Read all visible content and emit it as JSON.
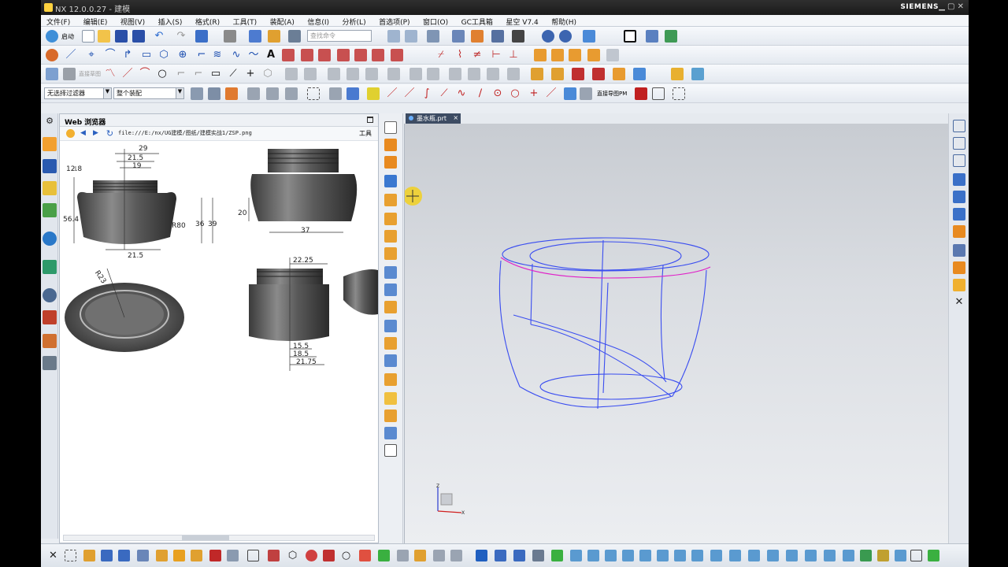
{
  "window": {
    "title": "NX 12.0.0.27 - 建模",
    "brand": "SIEMENS",
    "controls": "▁ ▢ ✕"
  },
  "menu": [
    "文件(F)",
    "编辑(E)",
    "视图(V)",
    "插入(S)",
    "格式(R)",
    "工具(T)",
    "装配(A)",
    "信息(I)",
    "分析(L)",
    "首选项(P)",
    "窗口(O)",
    "GC工具箱",
    "星空 V7.4",
    "帮助(H)"
  ],
  "toolbar": {
    "start_label": "启动",
    "search_placeholder": "查找命令",
    "filter_select": "无选择过滤器",
    "scope_select": "整个装配",
    "direct_sketch": "直接草图",
    "navigator_label": "直接导图PM"
  },
  "web_panel": {
    "title": "Web 浏览器",
    "url": "file:///E:/nx/UG建模/图纸/建模实战1/ZSP.png",
    "tools_label": "工具"
  },
  "drawing": {
    "dims": [
      "29",
      "21.5",
      "19",
      "12.8",
      "56.4",
      "R80",
      "36",
      "39",
      "21.5",
      "20",
      "37",
      "R23",
      "22.25",
      "15.5",
      "18.5",
      "21.75"
    ]
  },
  "graphics": {
    "tab_label": "墨水瓶.prt",
    "axis_z": "Z",
    "axis_x": "X",
    "colors": {
      "wire": "#3a4df0",
      "highlight": "#e020c8"
    }
  }
}
